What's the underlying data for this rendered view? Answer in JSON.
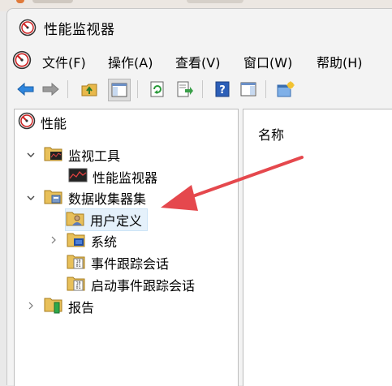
{
  "window": {
    "title": "性能监视器",
    "icon": "perfmon-icon"
  },
  "menu": [
    {
      "label": "文件(F)"
    },
    {
      "label": "操作(A)"
    },
    {
      "label": "查看(V)"
    },
    {
      "label": "窗口(W)"
    },
    {
      "label": "帮助(H)"
    }
  ],
  "toolbar": [
    {
      "icon": "back-arrow-icon"
    },
    {
      "icon": "forward-arrow-icon"
    },
    {
      "icon": "up-folder-icon"
    },
    {
      "icon": "show-hide-tree-icon"
    },
    {
      "icon": "refresh-icon"
    },
    {
      "icon": "export-list-icon"
    },
    {
      "icon": "help-icon"
    },
    {
      "icon": "show-hide-action-pane-icon"
    },
    {
      "icon": "new-window-icon"
    }
  ],
  "tree": {
    "root": "性能",
    "items": [
      {
        "label": "监视工具",
        "expanded": true,
        "icon": "monitor-folder-icon"
      },
      {
        "label": "性能监视器",
        "icon": "performance-chart-icon"
      },
      {
        "label": "数据收集器集",
        "expanded": true,
        "icon": "data-collector-folder-icon"
      },
      {
        "label": "用户定义",
        "selected": true,
        "icon": "user-defined-folder-icon"
      },
      {
        "label": "系统",
        "expanded": false,
        "icon": "system-folder-icon"
      },
      {
        "label": "事件跟踪会话",
        "icon": "event-trace-folder-icon"
      },
      {
        "label": "启动事件跟踪会话",
        "icon": "startup-trace-folder-icon"
      },
      {
        "label": "报告",
        "expanded": false,
        "icon": "report-folder-icon"
      }
    ]
  },
  "list": {
    "column_name": "名称"
  },
  "colors": {
    "selection_bg": "#e5f1fb",
    "annotation_arrow": "#e5484d"
  }
}
